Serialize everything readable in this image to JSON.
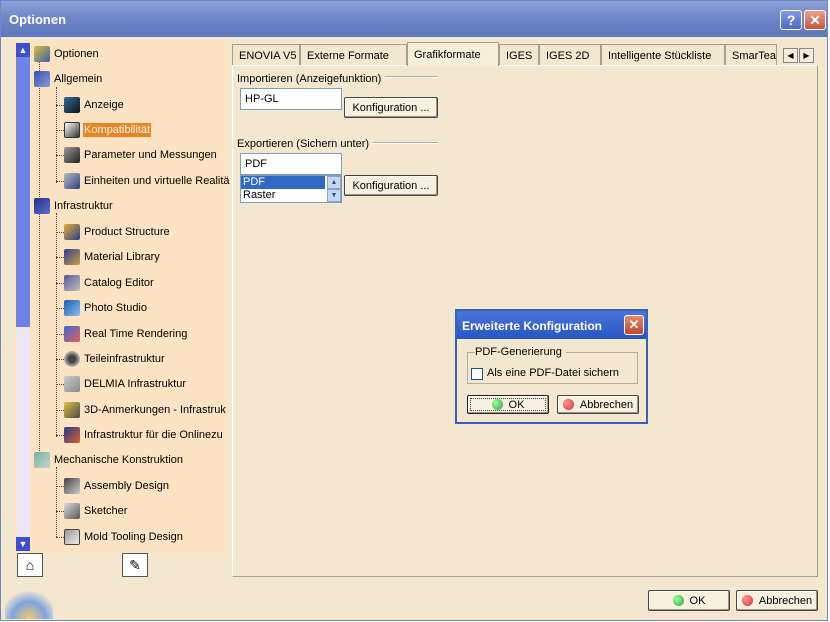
{
  "window": {
    "title": "Optionen",
    "help_glyph": "?",
    "close_glyph": "✕"
  },
  "tree": {
    "root": "Optionen",
    "allgemein": {
      "label": "Allgemein",
      "children": [
        "Anzeige",
        "Kompatibilität",
        "Parameter und Messungen",
        "Einheiten und virtuelle Realitä"
      ]
    },
    "infrastruktur": {
      "label": "Infrastruktur",
      "children": [
        "Product Structure",
        "Material Library",
        "Catalog Editor",
        "Photo Studio",
        "Real Time Rendering",
        "Teileinfrastruktur",
        "DELMIA Infrastruktur",
        "3D-Anmerkungen - Infrastruk",
        "Infrastruktur für die Onlinezu"
      ]
    },
    "mechanische": {
      "label": "Mechanische Konstruktion",
      "children": [
        "Assembly Design",
        "Sketcher",
        "Mold Tooling Design"
      ]
    },
    "selected": "Kompatibilität"
  },
  "tabs": [
    "ENOVIA V5",
    "Externe Formate",
    "Grafikformate",
    "IGES",
    "IGES 2D",
    "Intelligente Stückliste",
    "SmarTea"
  ],
  "active_tab": "Grafikformate",
  "import": {
    "group_label": "Importieren (Anzeigefunktion)",
    "value": "HP-GL",
    "button": "Konfiguration ..."
  },
  "export": {
    "group_label": "Exportieren (Sichern unter)",
    "value": "PDF",
    "list": [
      "PDF",
      "Raster"
    ],
    "selected": "PDF",
    "button": "Konfiguration ..."
  },
  "dialog": {
    "title": "Erweiterte Konfiguration",
    "close_glyph": "✕",
    "group_label": "PDF-Generierung",
    "checkbox_label": "Als eine PDF-Datei sichern",
    "checkbox_checked": false,
    "ok": "OK",
    "cancel": "Abbrechen"
  },
  "footer": {
    "ok": "OK",
    "cancel": "Abbrechen"
  },
  "colors": {
    "selection": "#f0831e",
    "titlebar": "#6f86c8",
    "ok_icon": "#2ea43b",
    "cancel_icon": "#d62a2a"
  }
}
